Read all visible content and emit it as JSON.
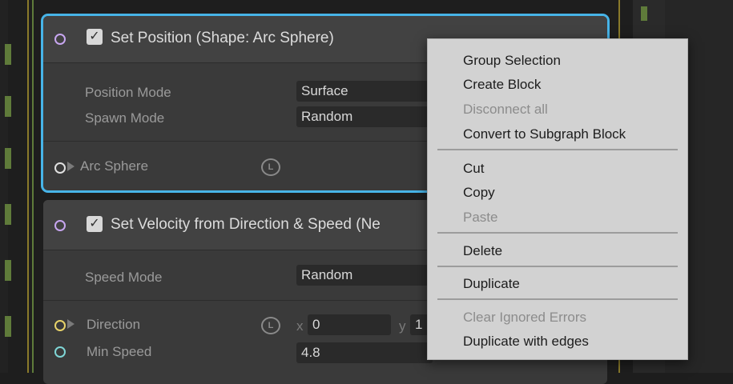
{
  "block1": {
    "title": "Set Position (Shape: Arc Sphere)",
    "checkbox_mark": "✓",
    "rows": [
      {
        "label": "Position Mode",
        "value": "Surface"
      },
      {
        "label": "Spawn Mode",
        "value": "Random"
      }
    ],
    "port_label": "Arc Sphere",
    "badge": "L"
  },
  "block2": {
    "title": "Set Velocity from Direction & Speed (Ne",
    "checkbox_mark": "✓",
    "speed_mode": {
      "label": "Speed Mode",
      "value": "Random"
    },
    "direction": {
      "label": "Direction",
      "badge": "L",
      "x_label": "x",
      "x_value": "0",
      "y_label": "y",
      "y_value": "1"
    },
    "min_speed": {
      "label": "Min Speed",
      "value": "4.8"
    }
  },
  "menu": {
    "items": [
      {
        "label": "Group Selection",
        "enabled": true
      },
      {
        "label": "Create Block",
        "enabled": true
      },
      {
        "label": "Disconnect all",
        "enabled": false
      },
      {
        "label": "Convert to Subgraph Block",
        "enabled": true
      },
      {
        "label": "Cut",
        "enabled": true
      },
      {
        "label": "Copy",
        "enabled": true
      },
      {
        "label": "Paste",
        "enabled": false
      },
      {
        "label": "Delete",
        "enabled": true
      },
      {
        "label": "Duplicate",
        "enabled": true
      },
      {
        "label": "Clear Ignored Errors",
        "enabled": false
      },
      {
        "label": "Duplicate with edges",
        "enabled": true
      }
    ]
  },
  "colors": {
    "selection_outline": "#47b4e8",
    "port_purple": "#c7a6f0",
    "port_yellow": "#e8d36a",
    "port_cyan": "#7fd6d6",
    "graph_green": "#5f7b3a"
  }
}
